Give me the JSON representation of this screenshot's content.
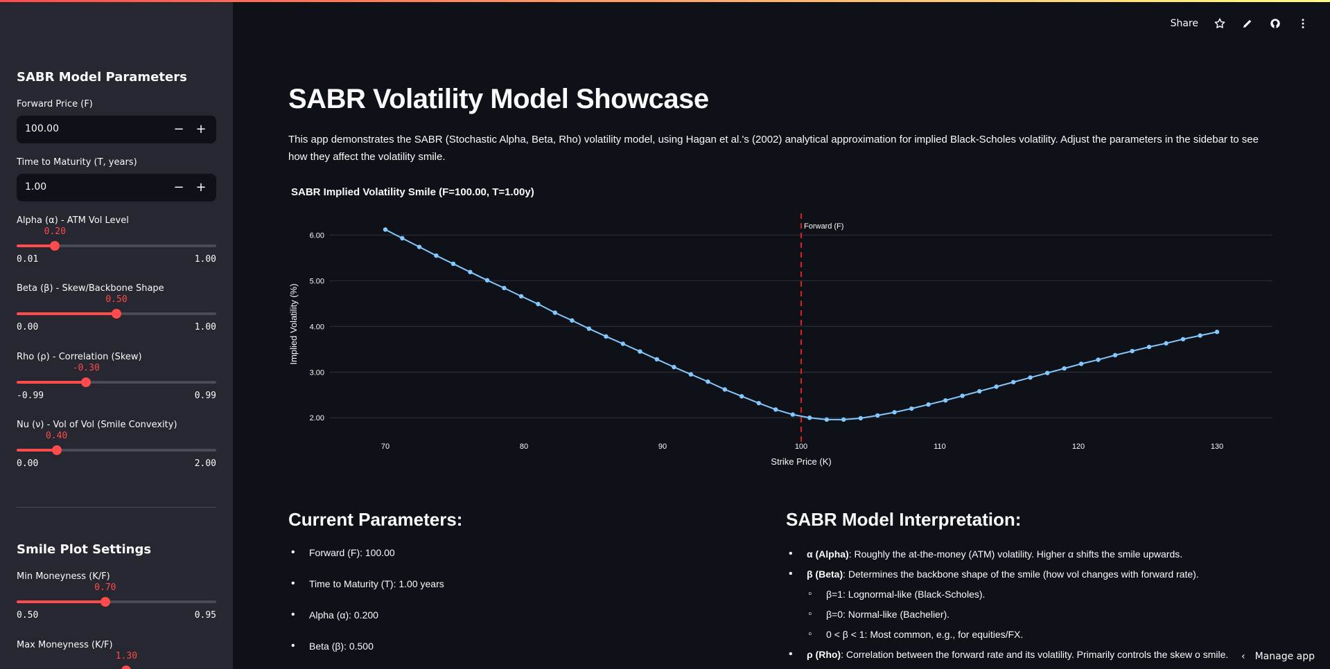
{
  "colors": {
    "accent": "#ff4b4b",
    "sidebar_bg": "#262730",
    "main_bg": "#0e1117",
    "line": "#83c9ff",
    "forward_line": "#e11d1d"
  },
  "header": {
    "share_label": "Share",
    "icons": [
      "star-icon",
      "edit-icon",
      "github-icon",
      "more-icon"
    ]
  },
  "sidebar": {
    "title": "SABR Model Parameters",
    "forward": {
      "label": "Forward Price (F)",
      "value": "100.00",
      "minus": "−",
      "plus": "+"
    },
    "maturity": {
      "label": "Time to Maturity (T, years)",
      "value": "1.00",
      "minus": "−",
      "plus": "+"
    },
    "sliders": [
      {
        "label": "Alpha (α) - ATM Vol Level",
        "current": "0.20",
        "min": "0.01",
        "max": "1.00",
        "fraction": 0.192
      },
      {
        "label": "Beta (β) - Skew/Backbone Shape",
        "current": "0.50",
        "min": "0.00",
        "max": "1.00",
        "fraction": 0.5
      },
      {
        "label": "Rho (ρ) - Correlation (Skew)",
        "current": "-0.30",
        "min": "-0.99",
        "max": "0.99",
        "fraction": 0.348
      },
      {
        "label": "Nu (ν) - Vol of Vol (Smile Convexity)",
        "current": "0.40",
        "min": "0.00",
        "max": "2.00",
        "fraction": 0.2
      }
    ],
    "smile_title": "Smile Plot Settings",
    "smile_sliders": [
      {
        "label": "Min Moneyness (K/F)",
        "current": "0.70",
        "min": "0.50",
        "max": "0.95",
        "fraction": 0.444
      },
      {
        "label": "Max Moneyness (K/F)",
        "current": "1.30",
        "min": "",
        "max": "",
        "fraction": 0.55
      }
    ]
  },
  "main": {
    "title": "SABR Volatility Model Showcase",
    "intro": "This app demonstrates the SABR (Stochastic Alpha, Beta, Rho) volatility model, using Hagan et al.'s (2002) analytical approximation for implied Black-Scholes volatility. Adjust the parameters in the sidebar to see how they affect the volatility smile.",
    "current_params_title": "Current Parameters:",
    "current_params": [
      "Forward (F): 100.00",
      "Time to Maturity (T): 1.00 years",
      "Alpha (α): 0.200",
      "Beta (β): 0.500"
    ],
    "interp_title": "SABR Model Interpretation:",
    "interp": [
      {
        "bold": "α (Alpha)",
        "text": ": Roughly the at-the-money (ATM) volatility. Higher α shifts the smile upwards.",
        "sub": false
      },
      {
        "bold": "β (Beta)",
        "text": ": Determines the backbone shape of the smile (how vol changes with forward rate).",
        "sub": false
      },
      {
        "bold": "",
        "text": "β=1: Lognormal-like (Black-Scholes).",
        "sub": true
      },
      {
        "bold": "",
        "text": "β=0: Normal-like (Bachelier).",
        "sub": true
      },
      {
        "bold": "",
        "text": "0 < β < 1: Most common, e.g., for equities/FX.",
        "sub": true
      },
      {
        "bold": "ρ (Rho)",
        "text": ": Correlation between the forward rate and its volatility. Primarily controls the skew o smile.",
        "sub": false
      }
    ],
    "manage_label": "Manage app"
  },
  "chart_data": {
    "type": "line",
    "title": "SABR Implied Volatility Smile (F=100.00, T=1.00y)",
    "xlabel": "Strike Price (K)",
    "ylabel": "Implied Volatility (%)",
    "xlim": [
      66,
      134
    ],
    "ylim": [
      1.7,
      6.4
    ],
    "x_ticks": [
      70,
      80,
      90,
      100,
      110,
      120,
      130
    ],
    "y_ticks": [
      2,
      3,
      4,
      5,
      6
    ],
    "y_tick_labels": [
      "2.00",
      "3.00",
      "4.00",
      "5.00",
      "6.00"
    ],
    "grid": true,
    "annotation": {
      "x": 100,
      "label": "Forward (F)"
    },
    "series": [
      {
        "x": [
          70,
          71.22,
          72.45,
          73.67,
          74.9,
          76.12,
          77.35,
          78.57,
          79.8,
          81.02,
          82.24,
          83.47,
          84.69,
          85.92,
          87.14,
          88.37,
          89.59,
          90.82,
          92.04,
          93.27,
          94.49,
          95.71,
          96.94,
          98.16,
          99.39,
          100.61,
          101.84,
          103.06,
          104.29,
          105.51,
          106.73,
          107.96,
          109.18,
          110.41,
          111.63,
          112.86,
          114.08,
          115.31,
          116.53,
          117.76,
          118.98,
          120.2,
          121.43,
          122.65,
          123.88,
          125.1,
          126.33,
          127.55,
          128.78,
          130
        ],
        "values": [
          6.12,
          5.93,
          5.74,
          5.55,
          5.37,
          5.19,
          5.01,
          4.84,
          4.66,
          4.49,
          4.3,
          4.13,
          3.95,
          3.78,
          3.62,
          3.45,
          3.28,
          3.11,
          2.95,
          2.79,
          2.62,
          2.47,
          2.32,
          2.18,
          2.07,
          2.0,
          1.96,
          1.96,
          1.99,
          2.05,
          2.12,
          2.2,
          2.29,
          2.38,
          2.48,
          2.58,
          2.68,
          2.78,
          2.88,
          2.98,
          3.08,
          3.18,
          3.27,
          3.37,
          3.46,
          3.55,
          3.63,
          3.72,
          3.8,
          3.88
        ]
      }
    ]
  }
}
